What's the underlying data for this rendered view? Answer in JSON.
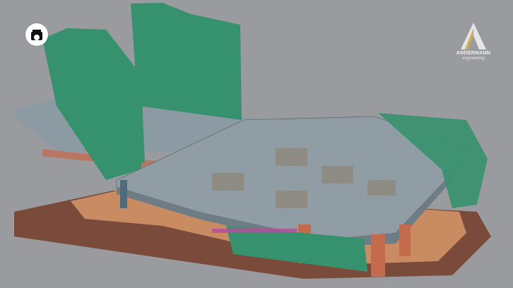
{
  "viewer": {
    "background": "#9a9b9e"
  },
  "logo_badge": {
    "icon": "building-arch-icon",
    "color": "#ffffff"
  },
  "brand": {
    "name": "ANDERMANN",
    "subtitle": "engineering",
    "accent": "#c7a73a"
  },
  "model_colors": {
    "slab": "#8e9aa2",
    "wall": "#2f8a6a",
    "base": "#c98b62",
    "site": "#7a4a3a",
    "column": "#c46a4d",
    "highlight": "#b44f9a"
  }
}
